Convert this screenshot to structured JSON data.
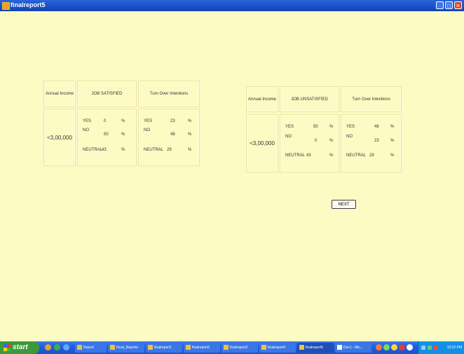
{
  "window": {
    "title": "finalreport5"
  },
  "table_left": {
    "headers": [
      "Annual Income",
      "JOB SATISFIED",
      "Turn Over Intentions"
    ],
    "income": "<3,00,000",
    "job": [
      {
        "label": "YES",
        "value": "0",
        "pct": "%"
      },
      {
        "label": "NO",
        "value": "50",
        "pct": "%"
      },
      {
        "label": "NEUTRAL",
        "value": "43",
        "pct": "%"
      }
    ],
    "turnover": [
      {
        "label": "YES",
        "value": "23",
        "pct": "%"
      },
      {
        "label": "NO",
        "value": "48",
        "pct": "%"
      },
      {
        "label": "NEUTRAL",
        "value": "29",
        "pct": "%"
      }
    ]
  },
  "table_right": {
    "headers": [
      "Annual Income",
      "JOB UNSATISFIED",
      "Turn Over Intentions"
    ],
    "income": "<3,00,000",
    "job": [
      {
        "label": "YES",
        "value": "50",
        "pct": "%"
      },
      {
        "label": "NO",
        "value": "0",
        "pct": "%"
      },
      {
        "label": "NEUTRAL",
        "value": "43",
        "pct": "%"
      }
    ],
    "turnover": [
      {
        "label": "YES",
        "value": "48",
        "pct": "%"
      },
      {
        "label": "NO",
        "value": "23",
        "pct": "%"
      },
      {
        "label": "NEUTRAL",
        "value": "29",
        "pct": "%"
      }
    ]
  },
  "buttons": {
    "next": "NEXT"
  },
  "taskbar": {
    "start": "start",
    "tasks": [
      "Report",
      "Final_Reports",
      "finalreport1",
      "finalreport2",
      "finalreport3",
      "finalreport4",
      "finalreport5",
      "Doc1 - Mic..."
    ],
    "clock": "10:32 PM"
  },
  "colors": {
    "background": "#fdfbc4",
    "titlebar": "#1a4fc8",
    "taskbar": "#245edb",
    "start": "#3c9a3c"
  }
}
